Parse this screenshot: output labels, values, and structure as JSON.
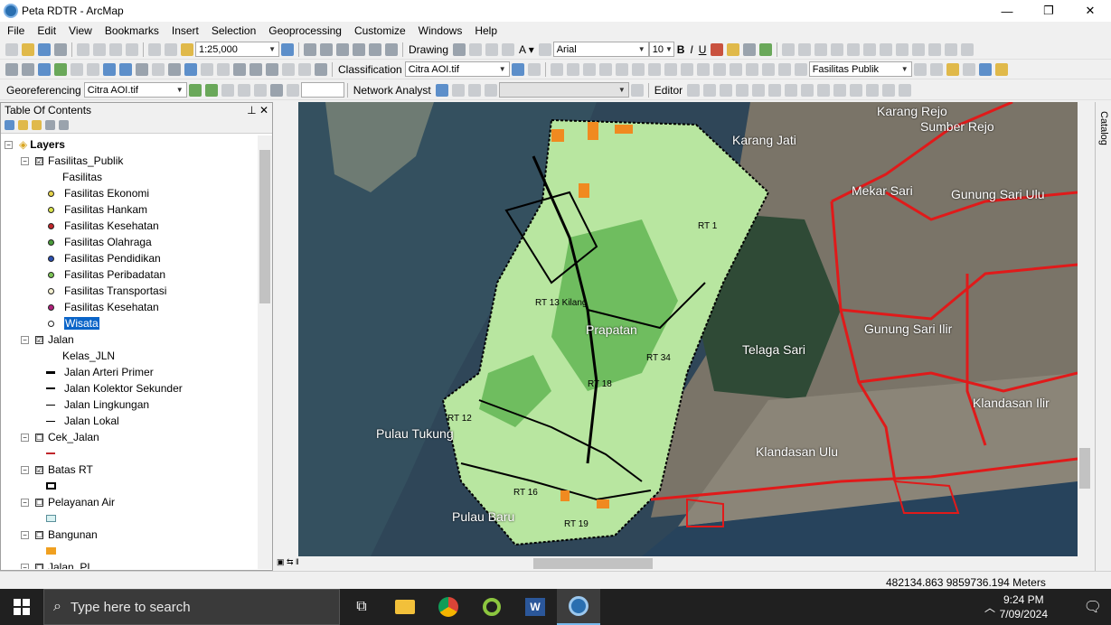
{
  "window": {
    "title": "Peta RDTR - ArcMap"
  },
  "menu": [
    "File",
    "Edit",
    "View",
    "Bookmarks",
    "Insert",
    "Selection",
    "Geoprocessing",
    "Customize",
    "Windows",
    "Help"
  ],
  "toolbar1": {
    "scale": "1:25,000",
    "drawing_label": "Drawing",
    "font": "Arial",
    "font_size": "10"
  },
  "toolbar2": {
    "classification_label": "Classification",
    "raster_layer": "Citra AOI.tif",
    "layer_select": "Fasilitas Publik"
  },
  "toolbar3": {
    "georef_label": "Georeferencing",
    "georef_layer": "Citra AOI.tif",
    "network_label": "Network Analyst",
    "editor_label": "Editor"
  },
  "toc": {
    "title": "Table Of Contents",
    "root": "Layers",
    "items": [
      {
        "label": "Fasilitas_Publik",
        "checked": "☑",
        "expand": "−"
      },
      {
        "label": "Fasilitas"
      },
      {
        "label": "Fasilitas Ekonomi",
        "color": "#e6d34a"
      },
      {
        "label": "Fasilitas Hankam",
        "color": "#d9e24c"
      },
      {
        "label": "Fasilitas Kesehatan",
        "color": "#c0262b"
      },
      {
        "label": "Fasilitas Olahraga",
        "color": "#4a9c3a"
      },
      {
        "label": "Fasilitas Pendidikan",
        "color": "#2b4fb0"
      },
      {
        "label": "Fasilitas Peribadatan",
        "color": "#7cc456"
      },
      {
        "label": "Fasilitas Transportasi",
        "color": "#f4f0d0"
      },
      {
        "label": "Fasilitas Kesehatan",
        "color": "#b0207a"
      },
      {
        "label": "Wisata",
        "color": "#ffffff",
        "selected": true
      },
      {
        "label": "Jalan",
        "checked": "☑",
        "expand": "−"
      },
      {
        "label": "Kelas_JLN"
      },
      {
        "label": "Jalan Arteri Primer"
      },
      {
        "label": "Jalan Kolektor Sekunder"
      },
      {
        "label": "Jalan Lingkungan"
      },
      {
        "label": "Jalan Lokal"
      },
      {
        "label": "Cek_Jalan",
        "checked": "☐",
        "expand": "−"
      },
      {
        "label": "Batas RT",
        "checked": "☑",
        "expand": "−"
      },
      {
        "label": "Pelayanan Air",
        "checked": "☐",
        "expand": "−"
      },
      {
        "label": "Bangunan",
        "checked": "☐",
        "expand": "−"
      },
      {
        "label": "Jalan_PL",
        "checked": "☐",
        "expand": "−"
      }
    ]
  },
  "map_labels": [
    "Karang Rejo",
    "Sumber Rejo",
    "Karang Jati",
    "Mekar Sari",
    "Gunung Sari Ulu",
    "Gunung Sari Ilir",
    "Telaga Sari",
    "Prapatan",
    "Klandasan Ilir",
    "Klandasan Ulu",
    "Pulau Tukung",
    "Pulau Baru",
    "RT 13 Kilang",
    "RT 18",
    "RT 12",
    "RT 16",
    "RT 19",
    "RT 1",
    "RT 34"
  ],
  "catalog_label": "Catalog",
  "status": {
    "coords": "482134.863  9859736.194 Meters"
  },
  "taskbar": {
    "search_placeholder": "Type here to search",
    "time": "9:24 PM",
    "date": "7/09/2024"
  }
}
